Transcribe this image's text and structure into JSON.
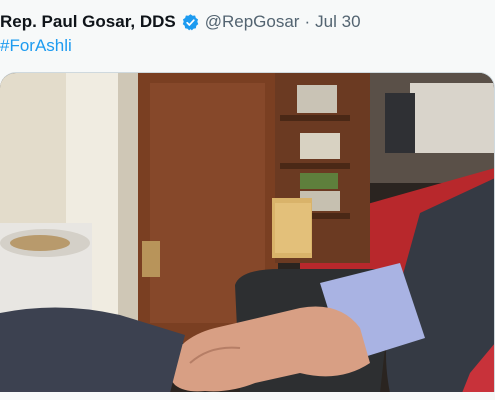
{
  "tweet": {
    "author_name": "Rep. Paul Gosar, DDS",
    "verified_icon": "verified-badge-icon",
    "handle": "@RepGosar",
    "separator": "·",
    "date": "Jul 30",
    "hashtag": "#ForAshli",
    "colors": {
      "link": "#1d9bf0",
      "verified": "#1d9bf0",
      "secondary_text": "#536471",
      "primary_text": "#0f1419"
    }
  }
}
